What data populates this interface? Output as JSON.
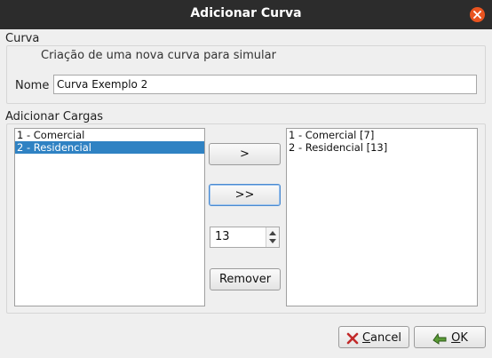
{
  "window": {
    "title": "Adicionar Curva"
  },
  "curva": {
    "section_label": "Curva",
    "description": "Criação de uma nova curva para simular",
    "name_label": "Nome",
    "name_value": "Curva Exemplo 2"
  },
  "cargas": {
    "section_label": "Adicionar Cargas",
    "available": [
      {
        "label": "1 - Comercial",
        "selected": false
      },
      {
        "label": "2 - Residencial",
        "selected": true
      }
    ],
    "added": [
      {
        "label": "1 - Comercial [7]"
      },
      {
        "label": "2 - Residencial [13]"
      }
    ],
    "add_button": ">",
    "add_all_button": ">>",
    "quantity_value": "13",
    "remove_button": "Remover"
  },
  "footer": {
    "cancel_first": "C",
    "cancel_rest": "ancel",
    "ok_first": "O",
    "ok_rest": "K"
  },
  "colors": {
    "titlebar": "#2c2c2c",
    "close_button": "#e95420",
    "selection": "#2f82c3",
    "ok_icon": "#3f7a25",
    "cancel_icon": "#c22a2a"
  }
}
